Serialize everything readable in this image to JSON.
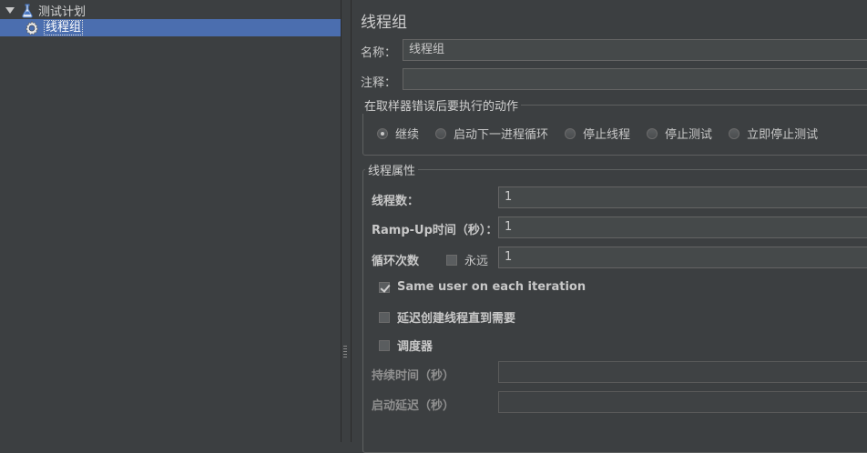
{
  "tree": {
    "root_label": "测试计划",
    "root_icon": "flask-icon",
    "child_label": "线程组",
    "child_icon": "gear-icon"
  },
  "panel": {
    "title": "线程组",
    "name_label": "名称：",
    "name_value": "线程组",
    "comment_label": "注释：",
    "comment_value": "",
    "error_group_title": "在取样器错误后要执行的动作",
    "error_actions": [
      {
        "label": "继续",
        "selected": true
      },
      {
        "label": "启动下一进程循环",
        "selected": false
      },
      {
        "label": "停止线程",
        "selected": false
      },
      {
        "label": "停止测试",
        "selected": false
      },
      {
        "label": "立即停止测试",
        "selected": false
      }
    ],
    "thread_props_title": "线程属性",
    "threads_label": "线程数：",
    "threads_value": "1",
    "rampup_label": "Ramp-Up时间（秒）：",
    "rampup_value": "1",
    "loop_label": "循环次数",
    "forever_label": "永远",
    "forever_checked": false,
    "loop_value": "1",
    "same_user_label": "Same user on each iteration",
    "same_user_checked": true,
    "delay_create_label": "延迟创建线程直到需要",
    "delay_create_checked": false,
    "scheduler_label": "调度器",
    "scheduler_checked": false,
    "duration_label": "持续时间（秒）",
    "duration_value": "",
    "startup_delay_label": "启动延迟（秒）",
    "startup_delay_value": ""
  },
  "colors": {
    "background": "#3c3f41",
    "selection": "#4b6eaf",
    "field_bg": "#45494a",
    "text": "#c8c8c8"
  }
}
